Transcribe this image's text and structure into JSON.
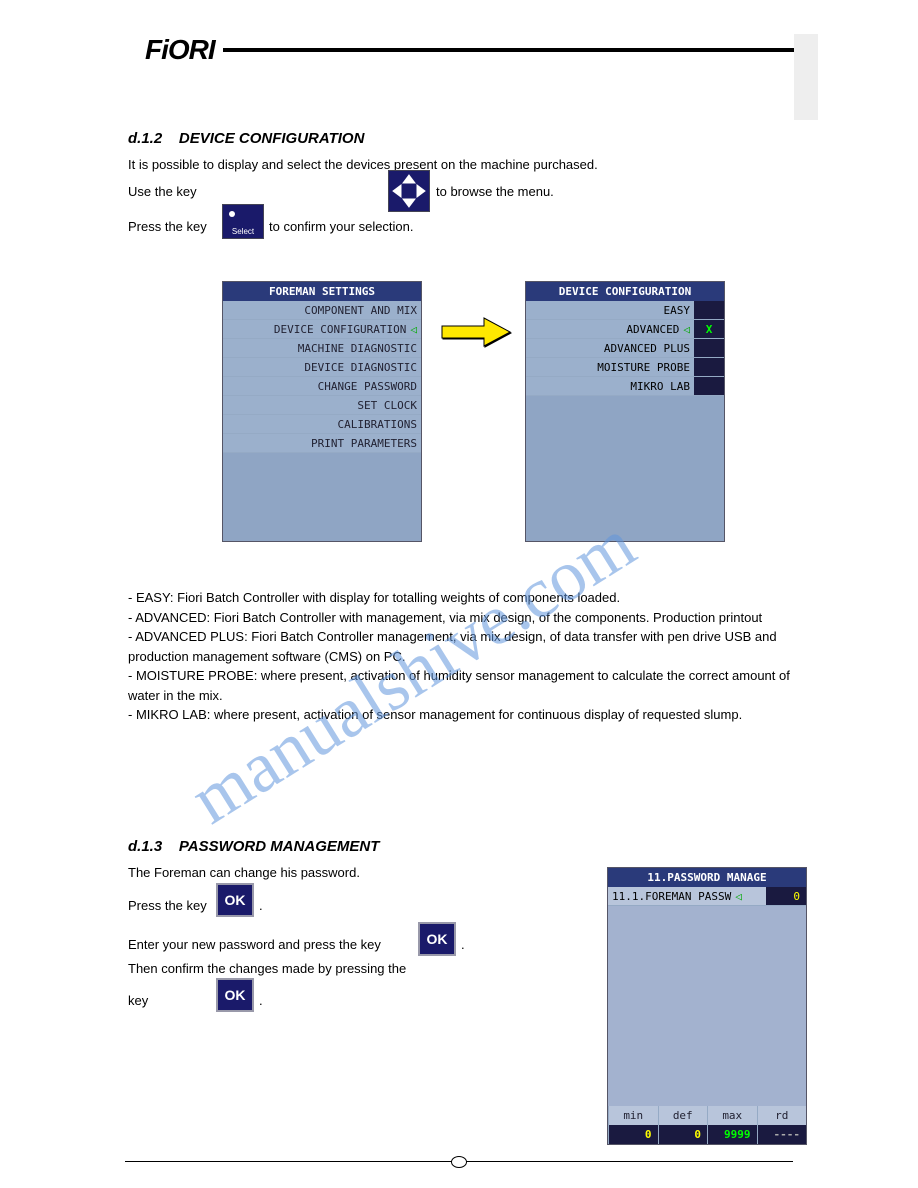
{
  "logo": "FiORI",
  "section": {
    "num": "d.1.2",
    "title": "DEVICE CONFIGURATION"
  },
  "intro": {
    "line1": "It is possible to display and select the devices present on the machine purchased.",
    "line2a": "Use the key ",
    "line2b": " to browse the menu.",
    "line3a": "Press the key ",
    "line3b": " to confirm your selection."
  },
  "icons": {
    "select_label": "Select",
    "ok": "OK"
  },
  "foreman_screen": {
    "title": "FOREMAN SETTINGS",
    "items": [
      "COMPONENT AND MIX",
      "DEVICE CONFIGURATION",
      "MACHINE DIAGNOSTIC",
      "DEVICE DIAGNOSTIC",
      "CHANGE PASSWORD",
      "SET CLOCK",
      "CALIBRATIONS",
      "PRINT PARAMETERS"
    ],
    "selected_index": 1
  },
  "device_screen": {
    "title": "DEVICE CONFIGURATION",
    "rows": [
      {
        "label": "EASY",
        "val": ""
      },
      {
        "label": "ADVANCED",
        "val": "X",
        "sel": true
      },
      {
        "label": "ADVANCED PLUS",
        "val": ""
      },
      {
        "label": "MOISTURE PROBE",
        "val": ""
      },
      {
        "label": "MIKRO LAB",
        "val": ""
      }
    ]
  },
  "bars": {
    "l1": "EASY: Fiori Batch Controller with display for totalling weights of components loaded.",
    "l2": "ADVANCED: Fiori Batch Controller with management, via mix design, of the components. Production printout",
    "l3": "ADVANCED PLUS: Fiori Batch Controller management, via mix design, of data transfer with pen drive USB and production management software (CMS) on PC.",
    "l4": "MOISTURE PROBE: where present, activation of humidity sensor management to calculate the correct amount of water in the mix.",
    "l5": "MIKRO LAB: where present, activation of sensor management for continuous display of requested slump."
  },
  "pw_section": {
    "num": "d.1.3",
    "title": "PASSWORD MANAGEMENT"
  },
  "pw_text": {
    "l1": "The Foreman can change his password.",
    "l2a": "Press the key ",
    "l2b": ".",
    "l3a": "Enter your new password and press the key ",
    "l3b": ".",
    "l4": "Then confirm the changes made by pressing the",
    "l5a": "key ",
    "l5b": "."
  },
  "pm_screen": {
    "title": "11.PASSWORD MANAGE",
    "row_label": "11.1.FOREMAN PASSW",
    "row_val": "0",
    "footer_h": [
      "min",
      "def",
      "max",
      "rd"
    ],
    "footer_v": [
      "0",
      "0",
      "9999",
      "----"
    ]
  },
  "watermark": "manualshive.com"
}
